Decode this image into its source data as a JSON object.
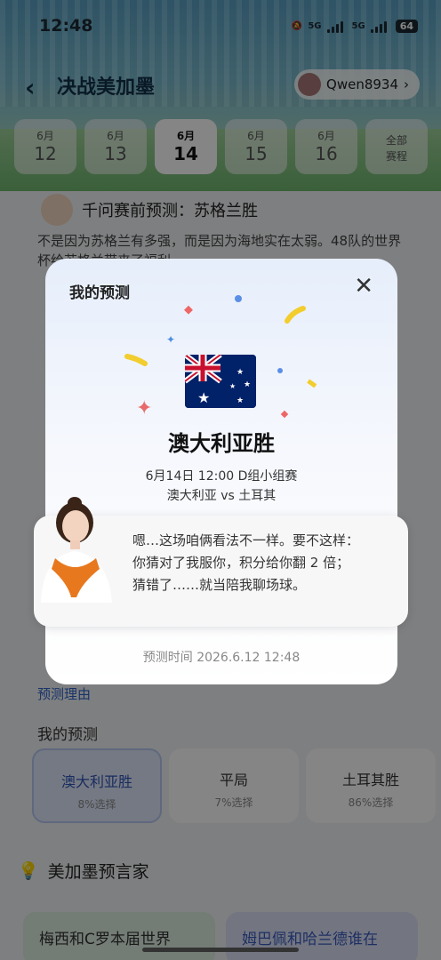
{
  "status_bar": {
    "time": "12:48",
    "signal1": "5G",
    "signal2": "5G",
    "battery": "64"
  },
  "header": {
    "title": "决战美加墨",
    "username": "Qwen8934"
  },
  "dates": [
    {
      "month": "6月",
      "day": "12"
    },
    {
      "month": "6月",
      "day": "13"
    },
    {
      "month": "6月",
      "day": "14"
    },
    {
      "month": "6月",
      "day": "15"
    },
    {
      "month": "6月",
      "day": "16"
    }
  ],
  "all_matches": {
    "line1": "全部",
    "line2": "赛程"
  },
  "background": {
    "prediction_title": "千问赛前预测：苏格兰胜",
    "prediction_text": "不是因为苏格兰有多强，而是因为海地实在太弱。48队的世界杯给苏格兰带来了福利",
    "reason_link": "预测理由",
    "my_prediction_label": "我的预测",
    "options": [
      {
        "label": "澳大利亚胜",
        "pct": "8%选择"
      },
      {
        "label": "平局",
        "pct": "7%选择"
      },
      {
        "label": "土耳其胜",
        "pct": "86%选择"
      }
    ],
    "seer_title": "美加墨预言家",
    "cards": [
      "梅西和C罗本届世界",
      "姆巴佩和哈兰德谁在"
    ]
  },
  "modal": {
    "title": "我的预测",
    "result": "澳大利亚胜",
    "match_info": "6月14日 12:00 D组小组赛",
    "teams": "澳大利亚 vs 土耳其",
    "predict_time": "预测时间 2026.6.12 12:48",
    "bubble_line1": "嗯…这场咱俩看法不一样。要不这样：",
    "bubble_line2": "你猜对了我服你，积分给你翻 2 倍；",
    "bubble_line3": "猜错了……就当陪我聊场球。"
  }
}
